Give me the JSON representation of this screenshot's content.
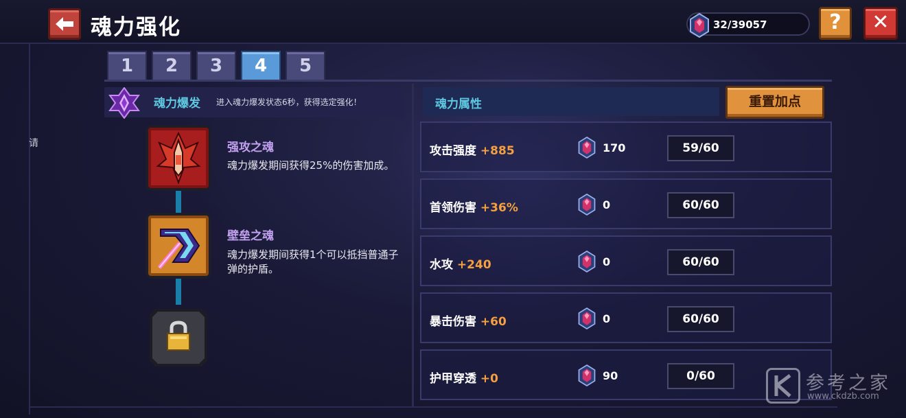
{
  "header": {
    "title": "魂力强化",
    "gem_count": "32/39057",
    "help_label": "?",
    "close_label": "✕"
  },
  "side_label": "请",
  "tabs": [
    "1",
    "2",
    "3",
    "4",
    "5"
  ],
  "active_tab": "4",
  "burst": {
    "name": "魂力爆发",
    "description": "进入魂力爆发状态6秒，获得选定强化！"
  },
  "skills": [
    {
      "name": "强攻之魂",
      "description": "魂力爆发期间获得25%的伤害加成。",
      "icon": "red-ship-icon"
    },
    {
      "name": "壁垒之魂",
      "description": "魂力爆发期间获得1个可以抵挡普通子弹的护盾。",
      "icon": "shield-boomerang-icon"
    },
    {
      "name": "",
      "description": "",
      "icon": "padlock-icon"
    }
  ],
  "attributes": {
    "header_label": "魂力属性",
    "reset_label": "重置加点",
    "rows": [
      {
        "name": "攻击强度",
        "bonus": "+885",
        "cost": "170",
        "level": "59/60"
      },
      {
        "name": "首领伤害",
        "bonus": "+36%",
        "cost": "0",
        "level": "60/60"
      },
      {
        "name": "水攻",
        "bonus": "+240",
        "cost": "0",
        "level": "60/60"
      },
      {
        "name": "暴击伤害",
        "bonus": "+60",
        "cost": "0",
        "level": "60/60"
      },
      {
        "name": "护甲穿透",
        "bonus": "+0",
        "cost": "90",
        "level": "0/60"
      }
    ]
  },
  "watermark": {
    "mark": "K",
    "name": "参考之家",
    "url": "www.ckdzb.com"
  },
  "colors": {
    "accent_cyan": "#5ec8e0",
    "bonus_orange": "#f5a040",
    "skill_purple": "#c2a0f0"
  }
}
